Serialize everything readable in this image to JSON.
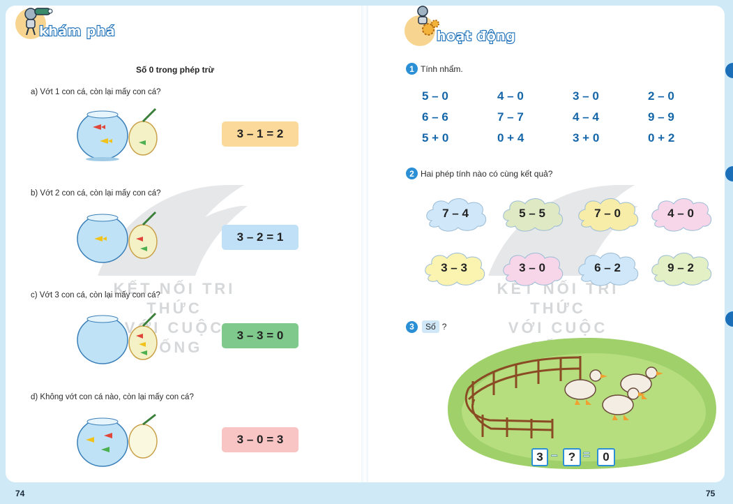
{
  "left_page": {
    "badge_title": "khám phá",
    "lesson_title": "Số 0 trong phép trừ",
    "questions": [
      {
        "text": "a) Vớt 1 con cá, còn lại mấy con cá?",
        "equation": "3 – 1 = 2",
        "color": "#fbd99a"
      },
      {
        "text": "b) Vớt 2 con cá, còn lại mấy con cá?",
        "equation": "3 – 2 = 1",
        "color": "#bfe0f6"
      },
      {
        "text": "c) Vớt 3 con cá, còn lại mấy con cá?",
        "equation": "3 – 3 = 0",
        "color": "#7ec98b"
      },
      {
        "text": "d) Không vớt con cá nào, còn lại mấy con cá?",
        "equation": "3 – 0 = 3",
        "color": "#f8c4c4"
      }
    ],
    "page_number": "74"
  },
  "watermark": {
    "line1": "KẾT NỐI TRI THỨC",
    "line2": "VỚI CUỘC SỐNG"
  },
  "right_page": {
    "badge_title": "hoạt động",
    "exercise1": {
      "number": "1",
      "title": "Tính nhẩm.",
      "rows": [
        [
          "5 – 0",
          "4 – 0",
          "3 – 0",
          "2 – 0"
        ],
        [
          "6 – 6",
          "7 – 7",
          "4 – 4",
          "9 – 9"
        ],
        [
          "5 + 0",
          "0 + 4",
          "3 + 0",
          "0 + 2"
        ]
      ]
    },
    "exercise2": {
      "number": "2",
      "title": "Hai phép tính nào có cùng kết quả?",
      "clouds": [
        {
          "text": "7 – 4",
          "color": "#cfe7f9"
        },
        {
          "text": "5 – 5",
          "color": "#dfe9c4"
        },
        {
          "text": "7 – 0",
          "color": "#f7eda8"
        },
        {
          "text": "4 – 0",
          "color": "#f7d6ea"
        },
        {
          "text": "3 – 3",
          "color": "#fbf3b0"
        },
        {
          "text": "3 – 0",
          "color": "#f7d6ea"
        },
        {
          "text": "6 – 2",
          "color": "#cfe7f9"
        },
        {
          "text": "9 – 2",
          "color": "#e3efc4"
        }
      ]
    },
    "exercise3": {
      "number": "3",
      "tag": "Số",
      "suffix": "?",
      "equation": {
        "a": "3",
        "op": "–",
        "b": "?",
        "eq": "=",
        "c": "0"
      }
    },
    "page_number": "75"
  }
}
